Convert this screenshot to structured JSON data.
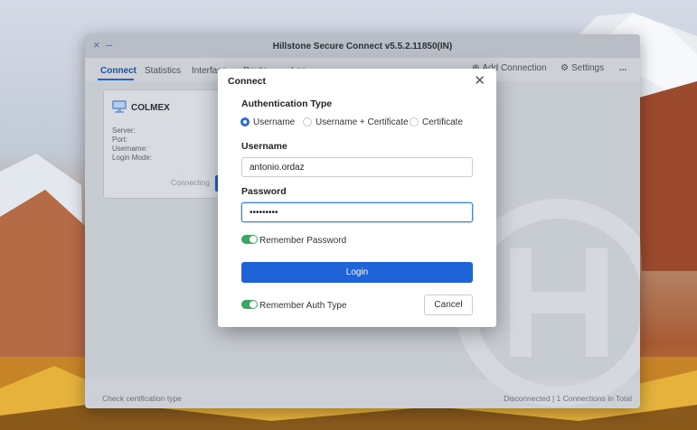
{
  "window": {
    "title": "Hillstone Secure Connect v5.5.2.11850(IN)",
    "close_icon": "×",
    "minimize_icon": "–"
  },
  "tabs": [
    {
      "label": "Connect",
      "active": true
    },
    {
      "label": "Statistics",
      "active": false
    },
    {
      "label": "Interface",
      "active": false
    },
    {
      "label": "Route",
      "active": false
    },
    {
      "label": "Log",
      "active": false
    }
  ],
  "toolbar": {
    "add_connection": "Add Connection",
    "settings": "Settings",
    "more": "..."
  },
  "connection_card": {
    "name": "COLMEX",
    "fields": [
      "Server:",
      "Port:",
      "Username:",
      "Login Mode:"
    ],
    "status": "Connecting"
  },
  "status_bar": {
    "left": "Check certification type",
    "right": "Disconnected  |  1 Connections in Total"
  },
  "dialog": {
    "title": "Connect",
    "auth_type_label": "Authentication Type",
    "auth_options": [
      {
        "label": "Username",
        "selected": true
      },
      {
        "label": "Username + Certificate",
        "selected": false
      },
      {
        "label": "Certificate",
        "selected": false
      }
    ],
    "username_label": "Username",
    "username_value": "antonio.ordaz",
    "password_label": "Password",
    "password_value": "•••••••••",
    "remember_password_label": "Remember Password",
    "remember_password_on": true,
    "login_label": "Login",
    "remember_auth_label": "Remember Auth Type",
    "remember_auth_on": true,
    "cancel_label": "Cancel"
  },
  "colors": {
    "accent": "#1e63d8",
    "toggle_on": "#38a860"
  }
}
